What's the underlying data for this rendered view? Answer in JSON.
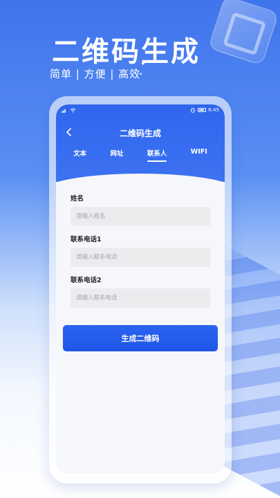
{
  "hero": {
    "title": "二维码生成",
    "subtitle": "简单 | 方便 | 高效"
  },
  "status_bar": {
    "time": "6:45"
  },
  "navbar": {
    "back_icon": "chevron-left-icon",
    "title": "二维码生成"
  },
  "tabs": [
    {
      "label": "文本",
      "active": false
    },
    {
      "label": "网址",
      "active": false
    },
    {
      "label": "联系人",
      "active": true
    },
    {
      "label": "WIFI",
      "active": false
    }
  ],
  "form": {
    "fields": [
      {
        "label": "姓名",
        "placeholder": "请输入姓名",
        "value": ""
      },
      {
        "label": "联系电话1",
        "placeholder": "请输入联系电话",
        "value": ""
      },
      {
        "label": "联系电话2",
        "placeholder": "请输入联系电话",
        "value": ""
      }
    ],
    "submit_label": "生成二维码"
  },
  "colors": {
    "primary": "#2f66ee",
    "button": "#1e55e6",
    "input_bg": "#ececef"
  }
}
